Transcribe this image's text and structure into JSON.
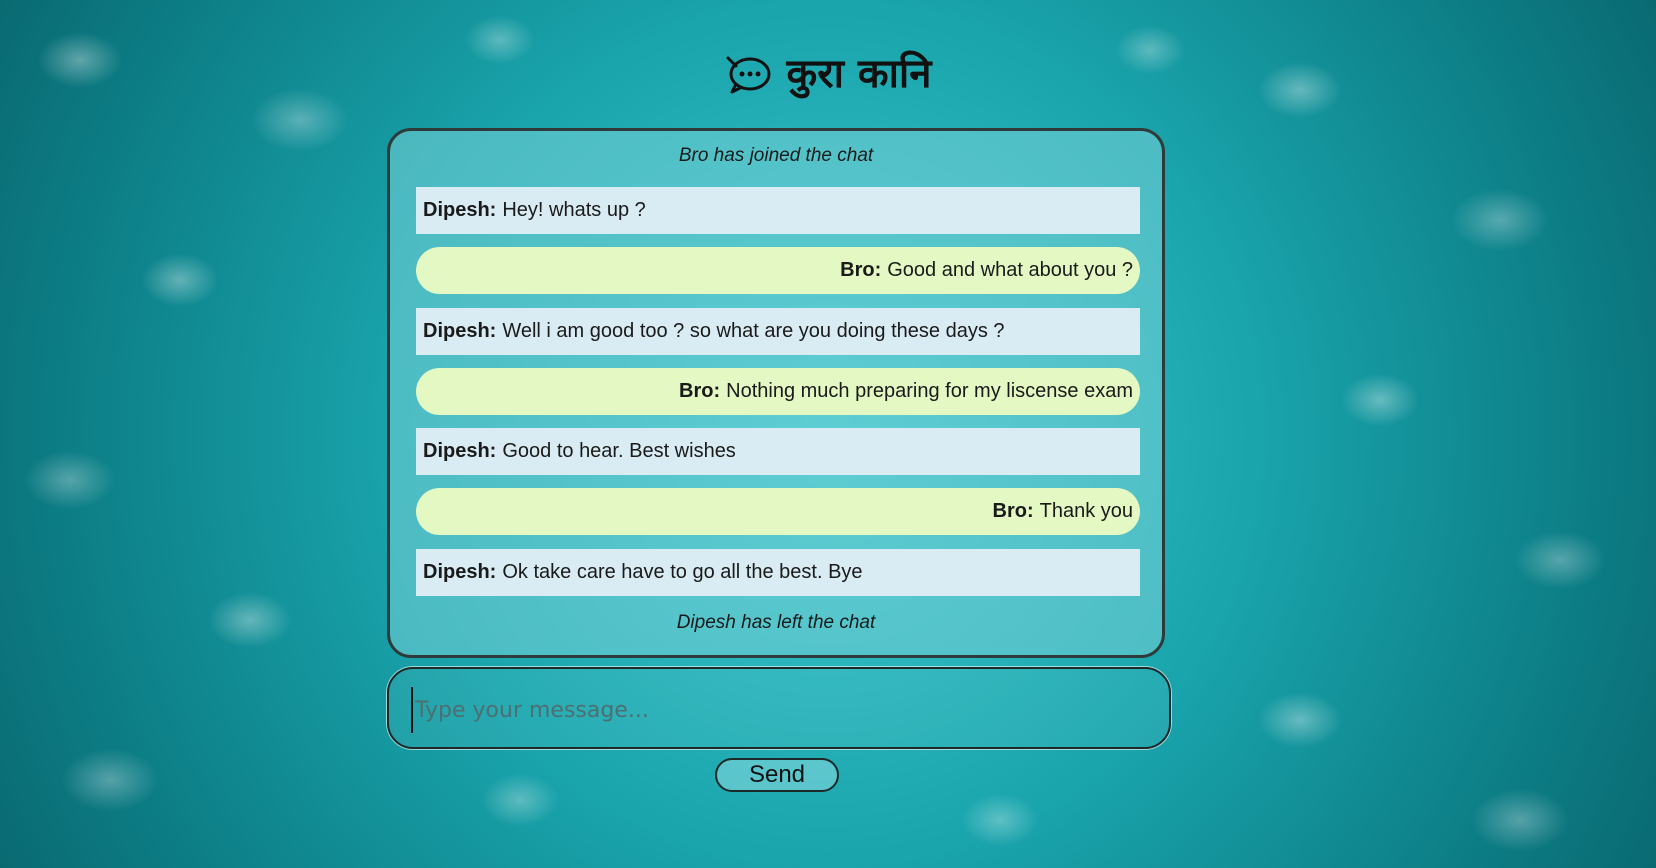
{
  "header": {
    "logo_icon": "chat-bubble-icon",
    "title": "कुरा कानि"
  },
  "chat": {
    "joined_text": "Bro has joined the chat",
    "left_text": "Dipesh has left the chat",
    "messages": [
      {
        "sender": "Dipesh:",
        "text": "Hey! whats up ?",
        "side": "left"
      },
      {
        "sender": "Bro:",
        "text": "Good and what about you ?",
        "side": "right"
      },
      {
        "sender": "Dipesh:",
        "text": "Well i am good too ? so what are you doing these days ?",
        "side": "left"
      },
      {
        "sender": "Bro:",
        "text": "Nothing much preparing for my liscense exam",
        "side": "right"
      },
      {
        "sender": "Dipesh:",
        "text": "Good to hear. Best wishes",
        "side": "left"
      },
      {
        "sender": "Bro:",
        "text": "Thank you",
        "side": "right"
      },
      {
        "sender": "Dipesh:",
        "text": "Ok take care have to go all the best. Bye",
        "side": "left"
      }
    ]
  },
  "composer": {
    "placeholder": "Type your message...",
    "value": "",
    "send_label": "Send"
  },
  "colors": {
    "incoming_bg": "#d9ecf4",
    "outgoing_bg": "#e3f8c3",
    "background": "#1aa5ad"
  }
}
